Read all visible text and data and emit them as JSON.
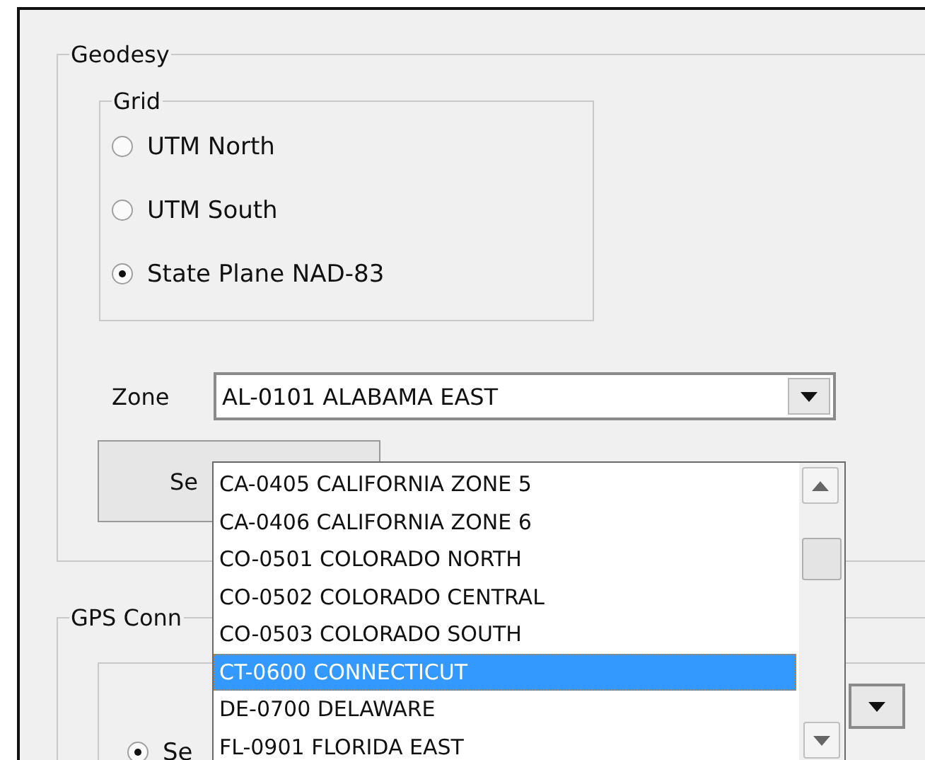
{
  "geodesy": {
    "title": "Geodesy",
    "grid": {
      "title": "Grid",
      "options": [
        {
          "label": "UTM North",
          "selected": false
        },
        {
          "label": "UTM South",
          "selected": false
        },
        {
          "label": "State Plane NAD-83",
          "selected": true
        }
      ]
    },
    "zone": {
      "label": "Zone",
      "value": "AL-0101 ALABAMA EAST",
      "expanded": true,
      "items": [
        {
          "label": "CA-0405 CALIFORNIA ZONE 5",
          "selected": false
        },
        {
          "label": "CA-0406 CALIFORNIA ZONE 6",
          "selected": false
        },
        {
          "label": "CO-0501 COLORADO NORTH",
          "selected": false
        },
        {
          "label": "CO-0502 COLORADO CENTRAL",
          "selected": false
        },
        {
          "label": "CO-0503 COLORADO SOUTH",
          "selected": false
        },
        {
          "label": "CT-0600 CONNECTICUT",
          "selected": true
        },
        {
          "label": "DE-0700 DELAWARE",
          "selected": false
        },
        {
          "label": "FL-0901 FLORIDA EAST",
          "selected": false
        }
      ]
    },
    "button": {
      "label": "Se"
    }
  },
  "gps": {
    "title": "GPS Conn",
    "options": [
      {
        "label": "Se",
        "selected": true
      }
    ]
  }
}
